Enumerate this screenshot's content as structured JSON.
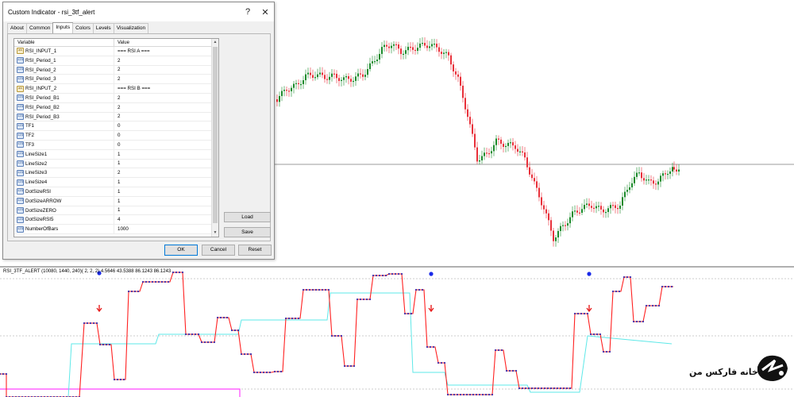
{
  "dialog": {
    "title": "Custom Indicator - rsi_3tf_alert",
    "help_label": "?",
    "close_label": "✕",
    "tabs": [
      {
        "label": "About"
      },
      {
        "label": "Common"
      },
      {
        "label": "Inputs"
      },
      {
        "label": "Colors"
      },
      {
        "label": "Levels"
      },
      {
        "label": "Visualization"
      }
    ],
    "active_tab": "Inputs",
    "grid_header": {
      "variable": "Variable",
      "value": "Value"
    },
    "rows": [
      {
        "type": "ab",
        "name": "RSI_INPUT_1",
        "value": "=== RSI A ==="
      },
      {
        "type": "123",
        "name": "RSI_Period_1",
        "value": "2"
      },
      {
        "type": "123",
        "name": "RSI_Period_2",
        "value": "2"
      },
      {
        "type": "123",
        "name": "RSI_Period_3",
        "value": "2"
      },
      {
        "type": "ab",
        "name": "RSI_INPUT_2",
        "value": "=== RSI B ==="
      },
      {
        "type": "123",
        "name": "RSI_Period_B1",
        "value": "2"
      },
      {
        "type": "123",
        "name": "RSI_Period_B2",
        "value": "2"
      },
      {
        "type": "123",
        "name": "RSI_Period_B3",
        "value": "2"
      },
      {
        "type": "123",
        "name": "TF1",
        "value": "0"
      },
      {
        "type": "123",
        "name": "TF2",
        "value": "0"
      },
      {
        "type": "123",
        "name": "TF3",
        "value": "0"
      },
      {
        "type": "123",
        "name": "LineSize1",
        "value": "1"
      },
      {
        "type": "123",
        "name": "LineSize2",
        "value": "1"
      },
      {
        "type": "123",
        "name": "LineSize3",
        "value": "2"
      },
      {
        "type": "123",
        "name": "LineSize4",
        "value": "1"
      },
      {
        "type": "123",
        "name": "DotSizeRSI",
        "value": "1"
      },
      {
        "type": "123",
        "name": "DotSizeARROW",
        "value": "1"
      },
      {
        "type": "123",
        "name": "DotSizeZERO",
        "value": "1"
      },
      {
        "type": "123",
        "name": "DotSizeRSI5",
        "value": "4"
      },
      {
        "type": "123",
        "name": "NumberOfBars",
        "value": "1000"
      }
    ],
    "load_label": "Load",
    "save_label": "Save",
    "ok_label": "OK",
    "cancel_label": "Cancel",
    "reset_label": "Reset"
  },
  "indicator": {
    "label": "RSI_3TF_ALERT (10080, 1440, 240)( 2, 2, 2)  4.5646 43.5388 86.1243 86.1243"
  },
  "watermark": {
    "text": "خانه فارکس من"
  },
  "colors": {
    "bull_candle": "#1a8a2a",
    "bear_candle": "#e8303a",
    "rsi_line": "#ff2020",
    "rsi_dots": "#3a2aa8",
    "cyan_line": "#5ee8e8",
    "magenta_line": "#ff44ff",
    "arrow": "#e82020",
    "blue_dot": "#1a2ae8"
  }
}
